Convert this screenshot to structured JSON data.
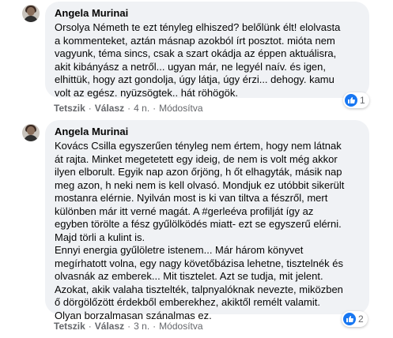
{
  "comments": [
    {
      "author": "Angela Murinai",
      "lines": [
        "Orsolya Németh te ezt tényleg elhiszed? belőlünk élt! elolvasta",
        "a kommenteket, aztán másnap azokból írt posztot. miótа nem",
        "vagyunk, téma sincs, csak a szart okádja az éppen aktuálisra,",
        "akit kibányász a netről... ugyan már, ne legyél naív. és igen,",
        "elhittük, hogy azt gondolja, úgy látja, úgy érzi... dehogy. kamu",
        "volt az egész. nyüzsögtek.. hát röhögök."
      ],
      "actions": {
        "like": "Tetszik",
        "reply": "Válasz",
        "time": "4 n.",
        "edited": "Módosítva"
      },
      "reaction_count": "1"
    },
    {
      "author": "Angela Murinai",
      "lines": [
        "Kovács Csilla egyszerűen tényleg nem értem, hogy nem látnak",
        "át rajta. Minket megetetett egy ideig, de nem is volt még akkor",
        "ilyen elborult. Egyik nap azon őrjöng, h őt elhagyták, másik nap",
        "meg azon, h neki nem is kell olvasó. Mondjuk ez utóbbit sikerült",
        "mostanra elérnie. Nyilván most is ki van tiltva a fészről, mert",
        "különben már itt verné magát. A #gerleéva profilját így az",
        "egyben törölte a fész gyűlölködés miatt- ezt se egyszerű elérni.",
        "Majd törli a kulint is.",
        "Ennyi energia gyűlöletre istenem... Már három könyvet",
        "megírhatott volna, egy nagy követőbázisa lehetne, tisztelnék és",
        "olvasnák az emberek... Mit tisztelet. Azt se tudja, mit jelent.",
        "Azokat, akik valaha tisztelték, talpnyalóknak nevezte, miközben",
        "ő dörgölőzött érdekből emberekhez, akiktől remélt valamit.",
        "Olyan borzalmasan szánalmas ez."
      ],
      "actions": {
        "like": "Tetszik",
        "reply": "Válasz",
        "time": "3 n.",
        "edited": "Módosítva"
      },
      "reaction_count": "2"
    }
  ],
  "colors": {
    "bubble": "#f0f2f5",
    "meta": "#65676b",
    "like_blue": "#1877f2"
  },
  "icons": {
    "avatar": "profile-photo",
    "reaction": "like-thumbs-up-icon"
  }
}
